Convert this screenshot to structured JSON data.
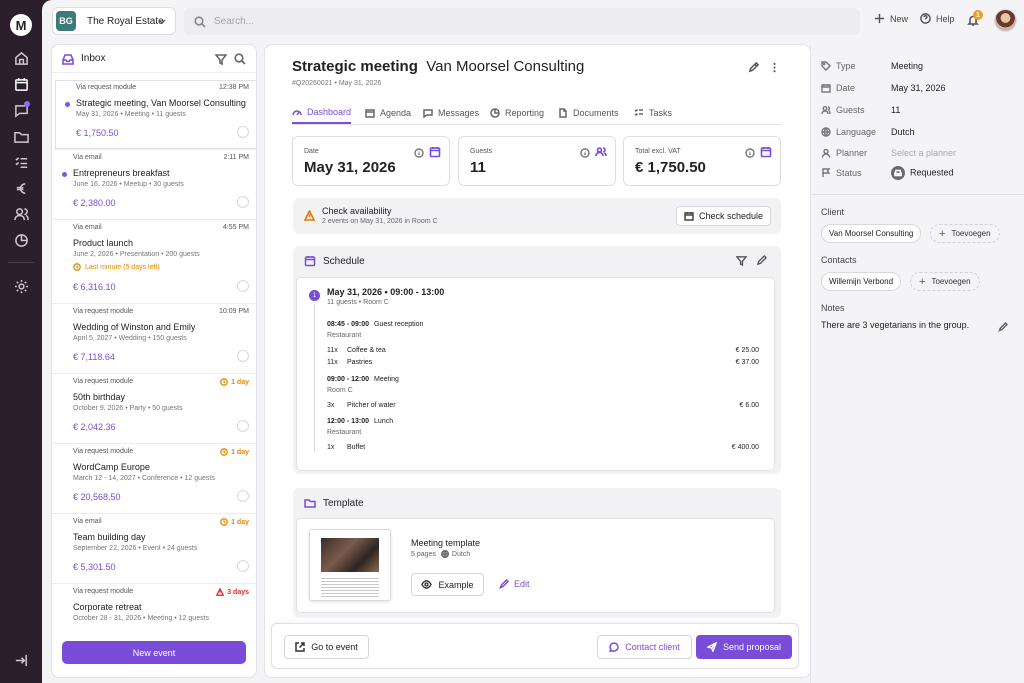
{
  "rail": {
    "logo": "M"
  },
  "org": {
    "badge": "BG",
    "name": "The Royal Estate"
  },
  "search": {
    "placeholder": "Search..."
  },
  "topbar": {
    "new_label": "New",
    "help_label": "Help",
    "notification_count": "1"
  },
  "inbox": {
    "title": "Inbox",
    "new_event_label": "New event",
    "items": [
      {
        "source": "Via request module",
        "time": "12:38 PM",
        "title": "Strategic meeting, Van Moorsel Consulting",
        "meta": "May 31, 2026  •  Meeting  •  11 guests",
        "price": "€ 1,750.50"
      },
      {
        "source": "Via email",
        "time": "2:11 PM",
        "title": "Entrepreneurs breakfast",
        "meta": "June 16, 2026  •  Meetup  •  30 guests",
        "price": "€ 2,380.00"
      },
      {
        "source": "Via email",
        "time": "4:55 PM",
        "title": "Product launch",
        "meta": "June 2, 2026  •  Presentation  •  200 guests",
        "warning": "Last minute (5 days left)",
        "price": "€ 6,316.10"
      },
      {
        "source": "Via request module",
        "time": "10:09 PM",
        "title": "Wedding of Winston and Emily",
        "meta": "April 5, 2027  •  Wedding  •  150 guests",
        "price": "€ 7,118.64"
      },
      {
        "source": "Via request module",
        "due": "1 day",
        "title": "50th birthday",
        "meta": "October 9, 2026  •  Party  •  50 guests",
        "price": "€ 2,042.36"
      },
      {
        "source": "Via request module",
        "due": "1 day",
        "title": "WordCamp Europe",
        "meta": "March 12 - 14, 2027  •  Conference  •  12 guests",
        "price": "€ 20,568.50"
      },
      {
        "source": "Via email",
        "due": "1 day",
        "title": "Team building day",
        "meta": "September 22, 2026  •  Event  •  24 guests",
        "price": "€ 5,301.50"
      },
      {
        "source": "Via request module",
        "due": "3 days",
        "title": "Corporate retreat",
        "meta": "October 28 - 31, 2026  •  Meeting  •  12 guests"
      }
    ]
  },
  "main": {
    "title_bold": "Strategic meeting",
    "title_rest": "Van Moorsel Consulting",
    "sub": "#Q20260021  •  May 31, 2026",
    "tabs": [
      "Dashboard",
      "Agenda",
      "Messages",
      "Reporting",
      "Documents",
      "Tasks"
    ],
    "stats": [
      {
        "label": "Date",
        "value": "May 31, 2026"
      },
      {
        "label": "Guests",
        "value": "11"
      },
      {
        "label": "Total excl. VAT",
        "value": "€ 1,750.50"
      }
    ],
    "alert": {
      "title": "Check availability",
      "sub": "2 events on May 31, 2026 in Room C",
      "button": "Check schedule"
    },
    "schedule": {
      "title": "Schedule",
      "num": "1",
      "day": "May 31, 2026 • 09:00 - 13:00",
      "day_sub": "11 guests • Room C",
      "blocks": [
        {
          "time": "08:45 - 09:00",
          "name": "Guest reception",
          "loc": "Restaurant",
          "rows": [
            {
              "q": "11x",
              "n": "Coffee & tea",
              "p": "€ 25.00"
            },
            {
              "q": "11x",
              "n": "Pastries",
              "p": "€ 37.00"
            }
          ]
        },
        {
          "time": "09:00 - 12:00",
          "name": "Meeting",
          "loc": "Room C",
          "rows": [
            {
              "q": "3x",
              "n": "Pitcher of water",
              "p": "€ 6.00"
            }
          ]
        },
        {
          "time": "12:00 - 13:00",
          "name": "Lunch",
          "loc": "Restaurant",
          "rows": [
            {
              "q": "1x",
              "n": "Buffet",
              "p": "€ 400.00"
            }
          ]
        }
      ]
    },
    "template": {
      "title": "Template",
      "name": "Meeting template",
      "pages": "5 pages",
      "language": "Dutch",
      "example_label": "Example",
      "edit_label": "Edit"
    },
    "footer": {
      "go_label": "Go to event",
      "contact_label": "Contact client",
      "send_label": "Send proposal"
    }
  },
  "side": {
    "props": [
      {
        "label": "Type",
        "value": "Meeting"
      },
      {
        "label": "Date",
        "value": "May 31, 2026"
      },
      {
        "label": "Guests",
        "value": "11"
      },
      {
        "label": "Language",
        "value": "Dutch"
      },
      {
        "label": "Planner",
        "placeholder": "Select a planner"
      },
      {
        "label": "Status",
        "value": "Requested"
      }
    ],
    "client_heading": "Client",
    "client": "Van Moorsel Consulting",
    "contacts_heading": "Contacts",
    "contact": "Willemijn Verbond",
    "add_label": "Toevoegen",
    "notes_heading": "Notes",
    "note": "There are 3 vegetarians in the group."
  },
  "colors": {
    "accent": "#7a4dd8",
    "rail": "#2b1f2c",
    "warning": "#e08a00",
    "danger": "#d93030"
  }
}
